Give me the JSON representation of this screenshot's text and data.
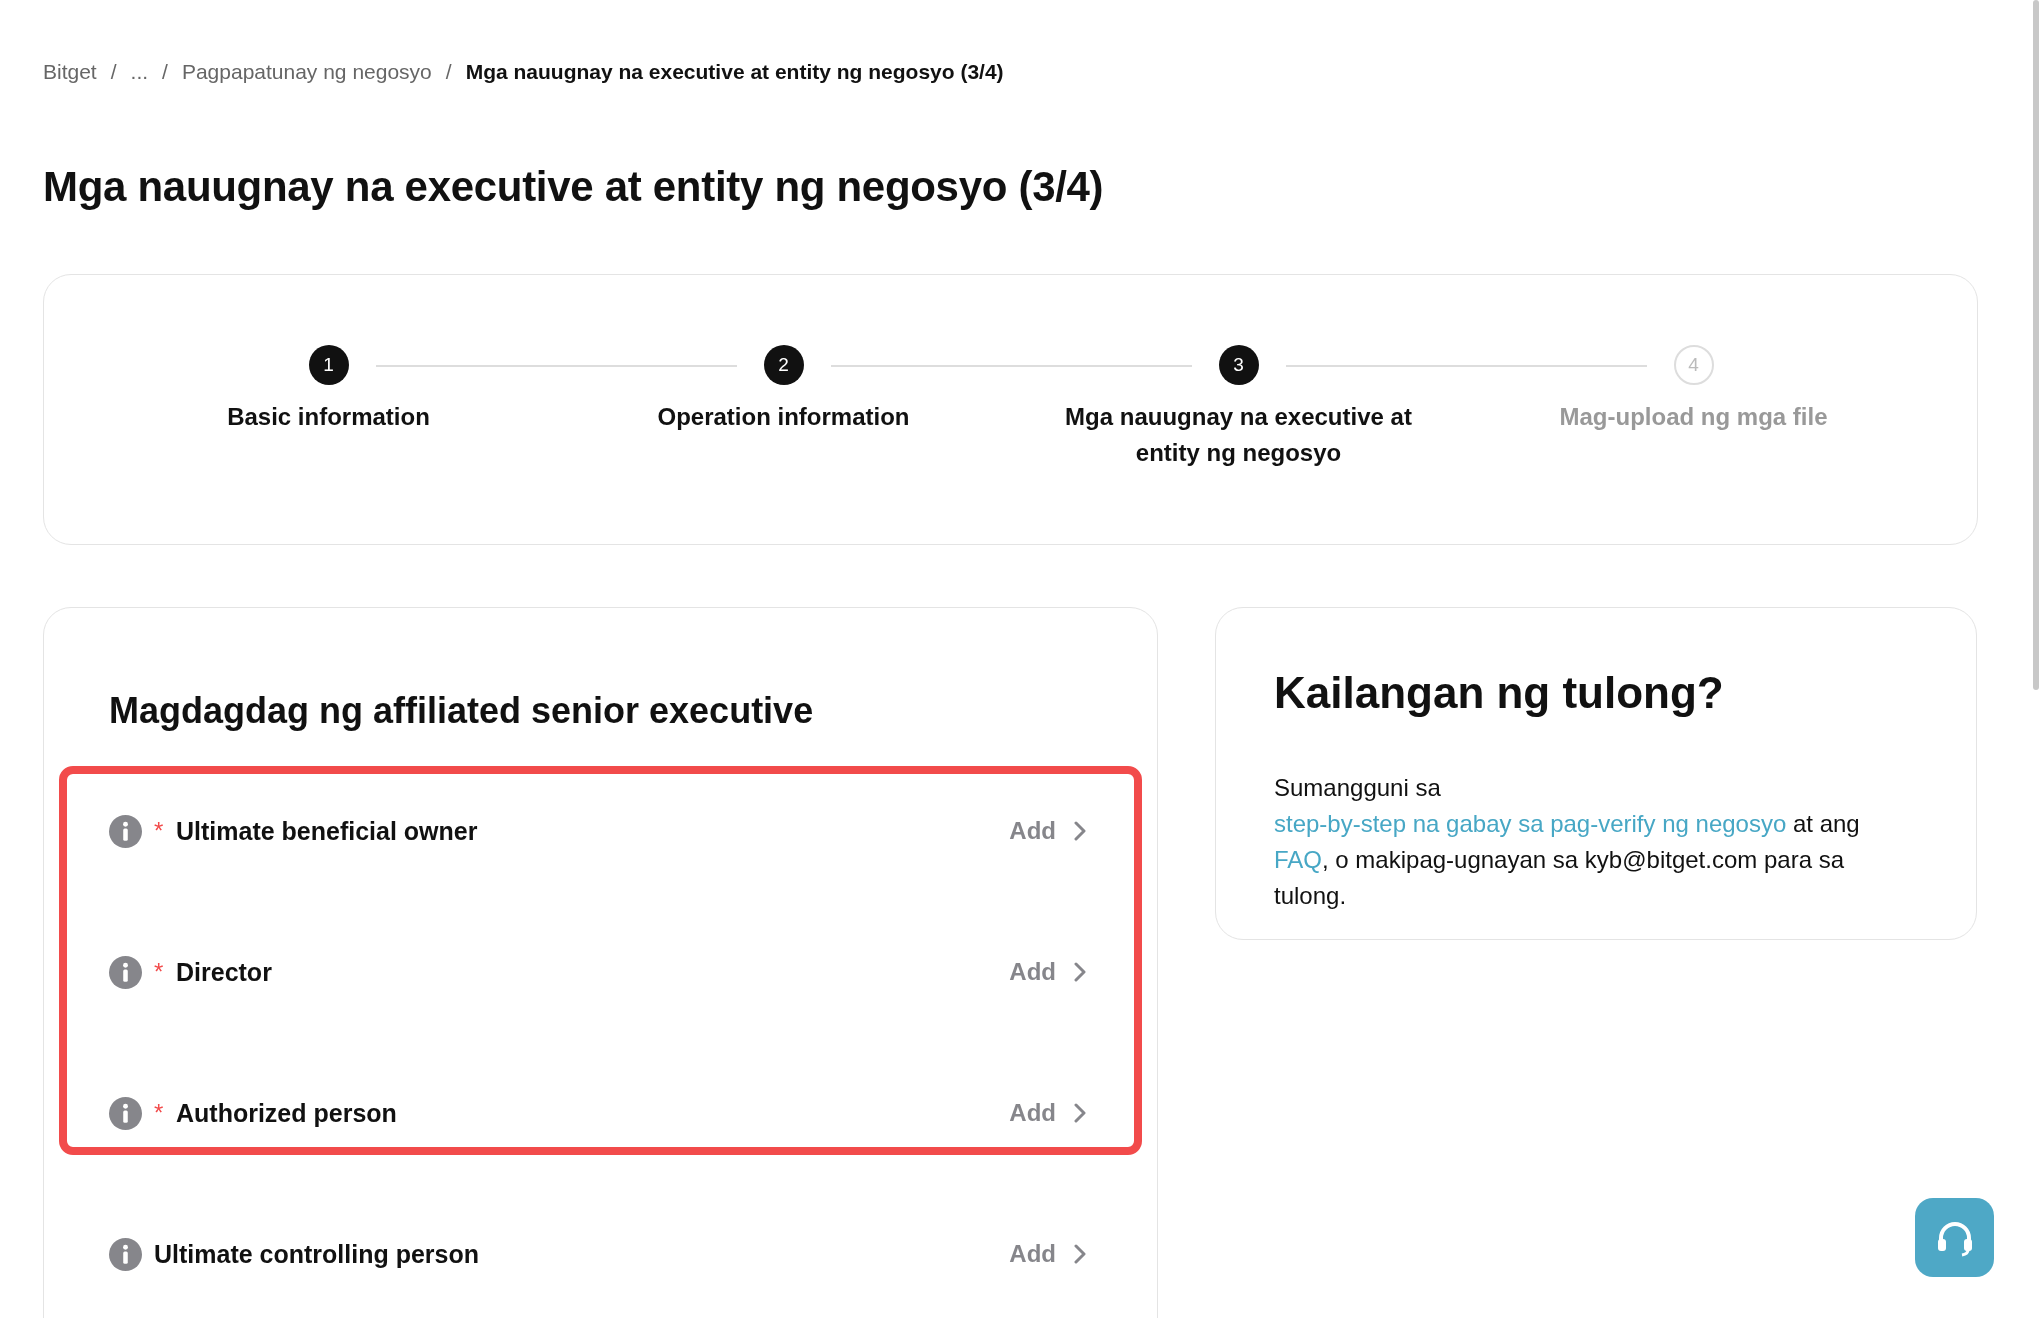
{
  "breadcrumb": [
    {
      "label": "Bitget",
      "current": false
    },
    {
      "label": "...",
      "current": false
    },
    {
      "label": "Pagpapatunay ng negosyo",
      "current": false
    },
    {
      "label": "Mga nauugnay na executive at entity ng negosyo (3/4)",
      "current": true
    }
  ],
  "separator": "/",
  "title": "Mga nauugnay na executive at entity ng negosyo (3/4)",
  "steps": [
    {
      "number": "1",
      "label": "Basic information",
      "active": true
    },
    {
      "number": "2",
      "label": "Operation information",
      "active": true
    },
    {
      "number": "3",
      "label": "Mga nauugnay na executive at entity ng negosyo",
      "active": true
    },
    {
      "number": "4",
      "label": "Mag-upload ng mga file",
      "active": false
    }
  ],
  "executives": {
    "title": "Magdagdag ng affiliated senior executive",
    "rows": [
      {
        "label": "Ultimate beneficial owner",
        "required": true,
        "highlighted": true,
        "action": "Add"
      },
      {
        "label": "Director",
        "required": true,
        "highlighted": true,
        "action": "Add"
      },
      {
        "label": "Authorized person",
        "required": true,
        "highlighted": true,
        "action": "Add"
      },
      {
        "label": "Ultimate controlling person",
        "required": false,
        "highlighted": false,
        "action": "Add"
      }
    ],
    "required_mark": "*"
  },
  "help": {
    "title": "Kailangan ng tulong?",
    "parts": [
      {
        "kind": "text",
        "text": "Sumangguni sa "
      },
      {
        "kind": "link",
        "text": "step-by-step na gabay sa pag-verify ng negosyo"
      },
      {
        "kind": "text",
        "text": " at ang "
      },
      {
        "kind": "link",
        "text": "FAQ"
      },
      {
        "kind": "text",
        "text": ", o makipag-ugnayan sa kyb@bitget.com para sa tulong."
      }
    ]
  }
}
